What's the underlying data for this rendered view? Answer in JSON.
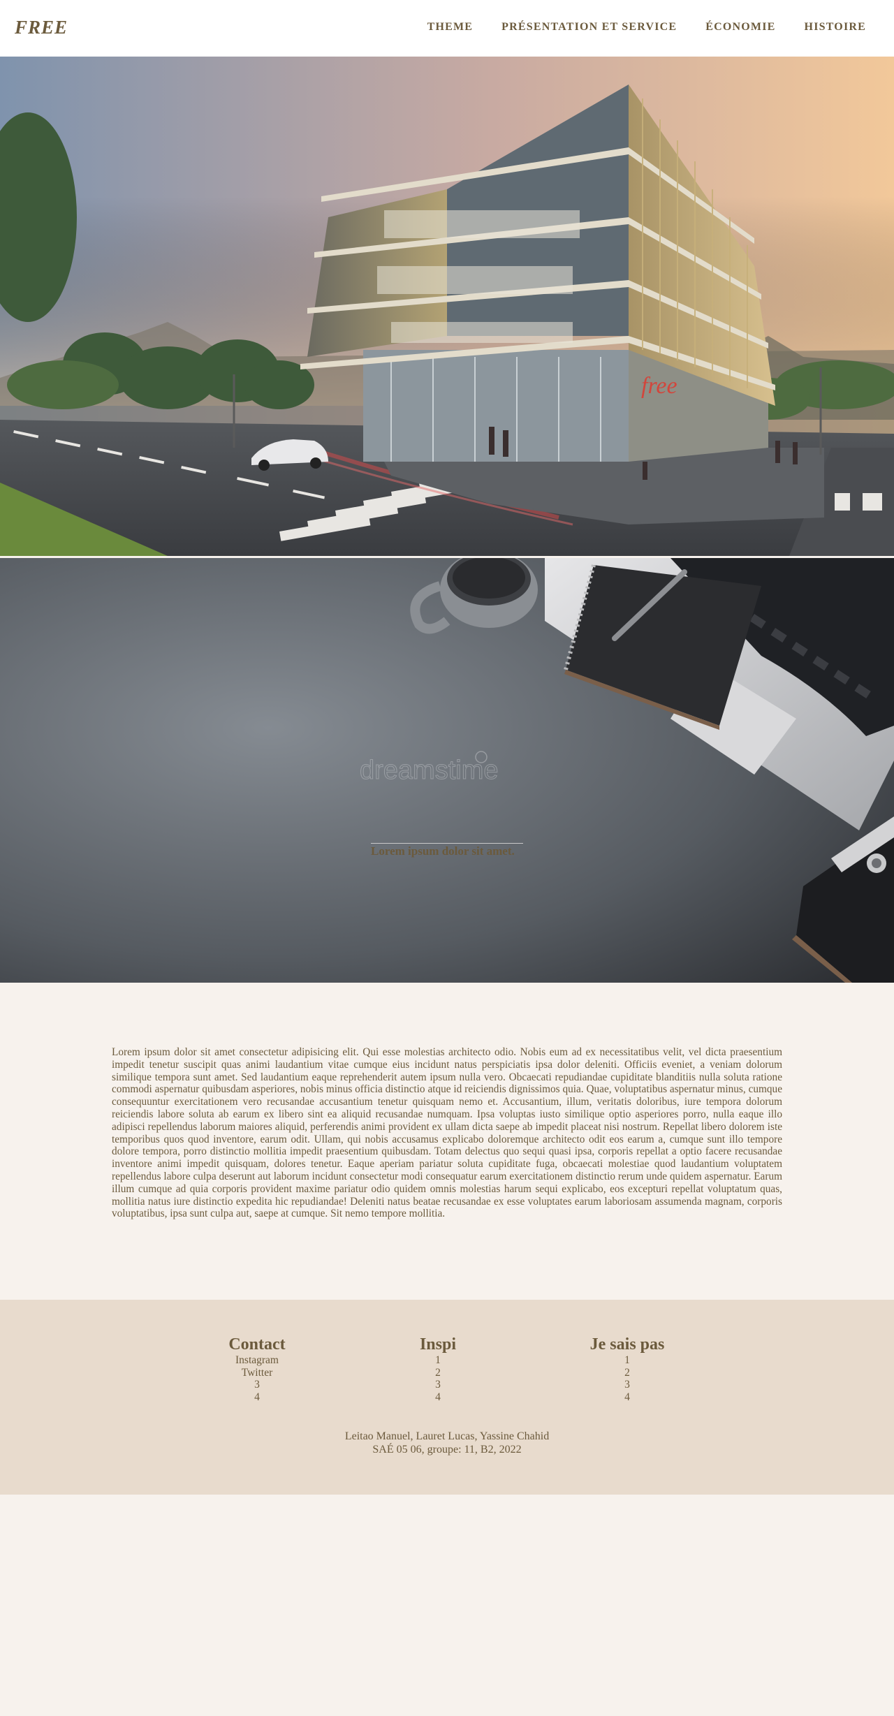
{
  "header": {
    "logo": "FREE",
    "nav": [
      "THEME",
      "PRÉSENTATION ET SERVICE",
      "ÉCONOMIE",
      "HISTOIRE"
    ]
  },
  "hero": {
    "storefront_sign": "free"
  },
  "desk": {
    "watermark": "dreamstime",
    "caption": "Lorem ipsum dolor sit amet."
  },
  "main": {
    "text": "Lorem ipsum dolor sit amet consectetur adipisicing elit. Qui esse molestias architecto odio. Nobis eum ad ex necessitatibus velit, vel dicta praesentium impedit tenetur suscipit quas animi laudantium vitae cumque eius incidunt natus perspiciatis ipsa dolor deleniti. Officiis eveniet, a veniam dolorum similique tempora sunt amet. Sed laudantium eaque reprehenderit autem ipsum nulla vero. Obcaecati repudiandae cupiditate blanditiis nulla soluta ratione commodi aspernatur quibusdam asperiores, nobis minus officia distinctio atque id reiciendis dignissimos quia. Quae, voluptatibus aspernatur minus, cumque consequuntur exercitationem vero recusandae accusantium tenetur quisquam nemo et. Accusantium, illum, veritatis doloribus, iure tempora dolorum reiciendis labore soluta ab earum ex libero sint ea aliquid recusandae numquam. Ipsa voluptas iusto similique optio asperiores porro, nulla eaque illo adipisci repellendus laborum maiores aliquid, perferendis animi provident ex ullam dicta saepe ab impedit placeat nisi nostrum. Repellat libero dolorem iste temporibus quos quod inventore, earum odit. Ullam, qui nobis accusamus explicabo doloremque architecto odit eos earum a, cumque sunt illo tempore dolore tempora, porro distinctio mollitia impedit praesentium quibusdam. Totam delectus quo sequi quasi ipsa, corporis repellat a optio facere recusandae inventore animi impedit quisquam, dolores tenetur. Eaque aperiam pariatur soluta cupiditate fuga, obcaecati molestiae quod laudantium voluptatem repellendus labore culpa deserunt aut laborum incidunt consectetur modi consequatur earum exercitationem distinctio rerum unde quidem aspernatur. Earum illum cumque ad quia corporis provident maxime pariatur odio quidem omnis molestias harum sequi explicabo, eos excepturi repellat voluptatum quas, mollitia natus iure distinctio expedita hic repudiandae! Deleniti natus beatae recusandae ex esse voluptates earum laboriosam assumenda magnam, corporis voluptatibus, ipsa sunt culpa aut, saepe at cumque. Sit nemo tempore mollitia."
  },
  "footer": {
    "columns": [
      {
        "title": "Contact",
        "items": [
          "Instagram",
          "Twitter",
          "3",
          "4"
        ]
      },
      {
        "title": "Inspi",
        "items": [
          "1",
          "2",
          "3",
          "4"
        ]
      },
      {
        "title": "Je sais pas",
        "items": [
          "1",
          "2",
          "3",
          "4"
        ]
      }
    ],
    "credits_line1": "Leitao Manuel, Lauret Lucas, Yassine Chahid",
    "credits_line2": "SAÉ 05 06, groupe: 11, B2, 2022"
  }
}
